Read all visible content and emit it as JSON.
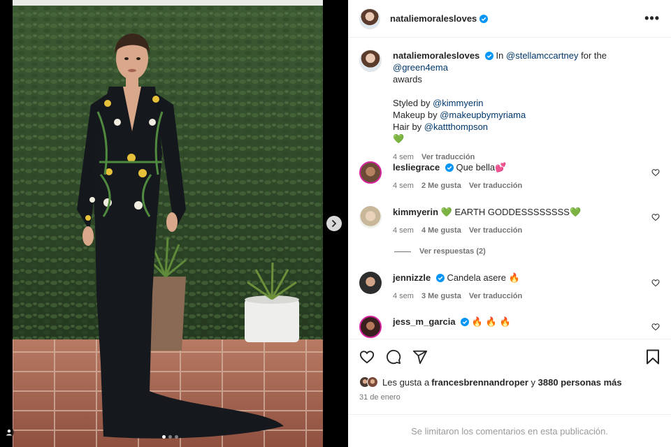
{
  "post": {
    "username": "nataliemoralesloves",
    "more_label": "•••"
  },
  "caption": {
    "username": "nataliemoralesloves",
    "line1_pre": "In ",
    "mention1": "@stellamccartney",
    "line1_mid": " for the ",
    "mention2": "@green4ema",
    "line2": "awards",
    "styled_pre": "Styled by ",
    "styled_mention": "@kimmyerin",
    "makeup_pre": "Makeup by ",
    "makeup_mention": "@makeupbymyriama",
    "hair_pre": "Hair by ",
    "hair_mention": "@kattthompson",
    "emoji": "💚",
    "time": "4 sem",
    "translate": "Ver traducción"
  },
  "comments": [
    {
      "user": "lesliegrace",
      "text": "Que bella💕",
      "time": "4 sem",
      "likes": "2 Me gusta",
      "translate": "Ver traducción",
      "verified": true,
      "avatar_color": "#6b4a36"
    },
    {
      "user": "kimmyerin",
      "text": "💚 EARTH GODDESSSSSSSS💚",
      "time": "4 sem",
      "likes": "4 Me gusta",
      "translate": "Ver traducción",
      "verified": false,
      "avatar_color": "#c9b79a"
    },
    {
      "user": "jennizzle",
      "text": "Candela asere 🔥",
      "time": "4 sem",
      "likes": "3 Me gusta",
      "translate": "Ver traducción",
      "verified": true,
      "avatar_color": "#2d2d2d"
    },
    {
      "user": "jess_m_garcia",
      "text": "🔥 🔥 🔥",
      "verified": true,
      "avatar_color": "#3a1f1f"
    }
  ],
  "replies_label": "Ver respuestas (2)",
  "likes": {
    "pre": "Les gusta a ",
    "user": "francesbrennandroper",
    "mid": " y ",
    "count": "3880 personas más"
  },
  "date": "31 de enero",
  "limited_comments": "Se limitaron los comentarios en esta publicación.",
  "carousel": {
    "slides": 3,
    "active": 1
  },
  "colors": {
    "verified": "#0095f6",
    "mention": "#00376b",
    "muted": "#737373"
  },
  "icons": [
    "verified-icon",
    "more-icon",
    "heart-icon",
    "comment-icon",
    "share-icon",
    "bookmark-icon",
    "chevron-right-icon"
  ]
}
